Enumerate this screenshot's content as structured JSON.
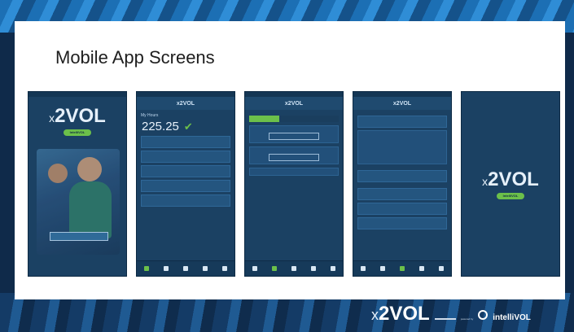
{
  "slide": {
    "title": "Mobile App Screens"
  },
  "phones": [
    {
      "id": "splash-login",
      "logo_x": "x",
      "logo_word": "2VOL",
      "badge": "IntelliVOL"
    },
    {
      "id": "dashboard",
      "header": "x2VOL",
      "section": "My Hours",
      "total": "225.25"
    },
    {
      "id": "opportunities",
      "header": "x2VOL"
    },
    {
      "id": "log-hours",
      "header": "x2VOL"
    },
    {
      "id": "splash-logo",
      "logo_x": "x",
      "logo_word": "2VOL",
      "badge": "IntelliVOL"
    }
  ],
  "footer": {
    "logo_x": "x",
    "logo_word": "2VOL",
    "powered_by": "powered by",
    "intellivol": "intelliVOL"
  },
  "colors": {
    "accent_green": "#6cc04a",
    "phone_bg": "#1b4163",
    "banner_blue": "#1c6fb4"
  }
}
